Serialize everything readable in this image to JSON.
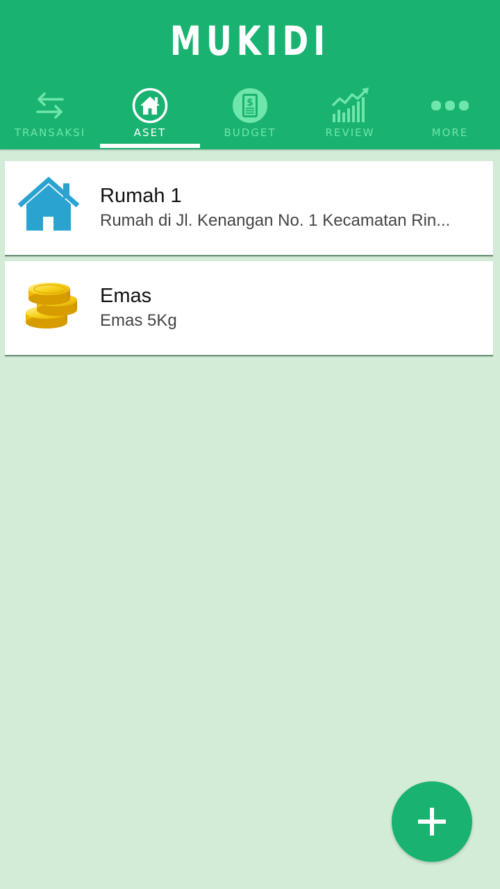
{
  "app": {
    "title": "MUKIDI"
  },
  "tabs": [
    {
      "label": "TRANSAKSI",
      "icon": "swap-arrows-icon",
      "active": false
    },
    {
      "label": "ASET",
      "icon": "home-icon",
      "active": true
    },
    {
      "label": "BUDGET",
      "icon": "budget-dollar-icon",
      "active": false
    },
    {
      "label": "REVIEW",
      "icon": "chart-growth-icon",
      "active": false
    },
    {
      "label": "MORE",
      "icon": "more-dots-icon",
      "active": false
    }
  ],
  "assets": [
    {
      "title": "Rumah 1",
      "subtitle": "Rumah di Jl. Kenangan  No. 1 Kecamatan Rin...",
      "icon": "house-icon"
    },
    {
      "title": "Emas",
      "subtitle": "Emas 5Kg",
      "icon": "gold-coins-icon"
    }
  ],
  "fab": {
    "icon": "plus-icon"
  },
  "colors": {
    "primary": "#19b270",
    "background": "#d3ecd8",
    "tab_inactive": "#6fe6ab",
    "house_blue": "#2aa3d0",
    "gold": "#f2c200"
  }
}
